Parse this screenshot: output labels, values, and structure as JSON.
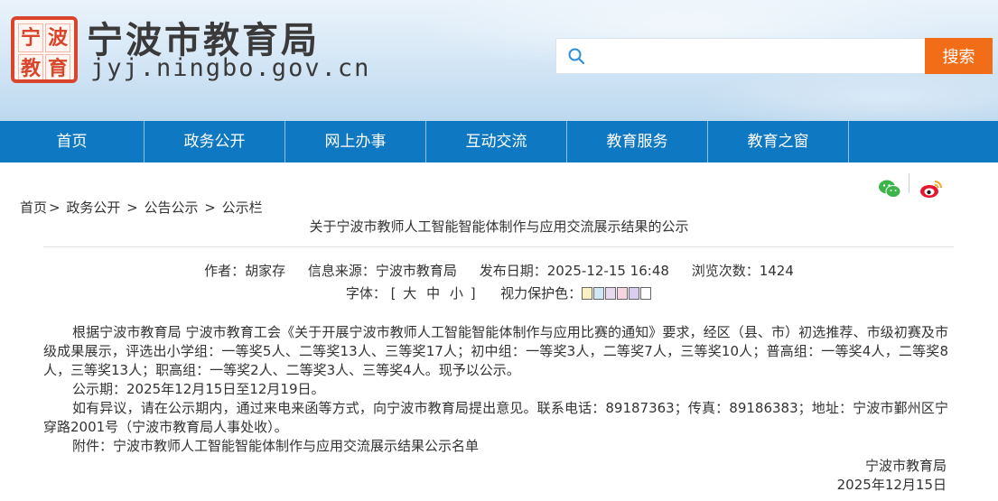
{
  "header": {
    "seal_chars": [
      "宁",
      "波",
      "教",
      "育"
    ],
    "site_title": "宁波市教育局",
    "site_domain": "jyj.ningbo.gov.cn",
    "search": {
      "placeholder": "",
      "value": "",
      "button_label": "搜索",
      "icon": "search-icon"
    }
  },
  "nav": {
    "items": [
      "首页",
      "政务公开",
      "网上办事",
      "互动交流",
      "教育服务",
      "教育之窗"
    ]
  },
  "share": {
    "icons": [
      "wechat-icon",
      "weibo-icon"
    ]
  },
  "breadcrumb": {
    "items": [
      "首页",
      "政务公开",
      "公告公示",
      "公示栏"
    ],
    "separator_1": ">",
    "separator_2": " > ",
    "separator_3": " > "
  },
  "article": {
    "title": "关于宁波市教师人工智能智能体制作与应用交流展示结果的公示",
    "meta": {
      "author_label": "作者：",
      "author": "胡家存",
      "source_label": "信息来源：",
      "source": "宁波市教育局",
      "date_label": "发布日期：",
      "date": "2025-12-15 16:48",
      "views_label": "浏览次数：",
      "views": "1424"
    },
    "font_label": "字体：",
    "font_bracket_open": "[",
    "font_sizes": [
      "大",
      "中",
      "小"
    ],
    "font_bracket_close": "]",
    "eye_label": "视力保护色：",
    "eye_colors": [
      "#f9f1c0",
      "#cfe7f5",
      "#e8d9ef",
      "#f6d5e1",
      "#d9cdf0",
      "#ffffff"
    ],
    "paragraphs": [
      "根据宁波市教育局 宁波市教育工会《关于开展宁波市教师人工智能智能体制作与应用比赛的通知》要求，经区（县、市）初选推荐、市级初赛及市级成果展示，评选出小学组：一等奖5人、二等奖13人、三等奖17人；初中组：一等奖3人，二等奖7人，三等奖10人；普高组：一等奖4人，二等奖8人，三等奖13人；职高组：一等奖2人、二等奖3人、三等奖4人。现予以公示。",
      "公示期：2025年12月15日至12月19日。",
      "如有异议，请在公示期内，通过来电来函等方式，向宁波市教育局提出意见。联系电话：89187363；传真：89186383；地址：宁波市鄞州区宁穿路2001号（宁波市教育局人事处收）。",
      "附件：宁波市教师人工智能智能体制作与应用交流展示结果公示名单"
    ],
    "signature_org": "宁波市教育局",
    "signature_date": "2025年12月15日"
  }
}
